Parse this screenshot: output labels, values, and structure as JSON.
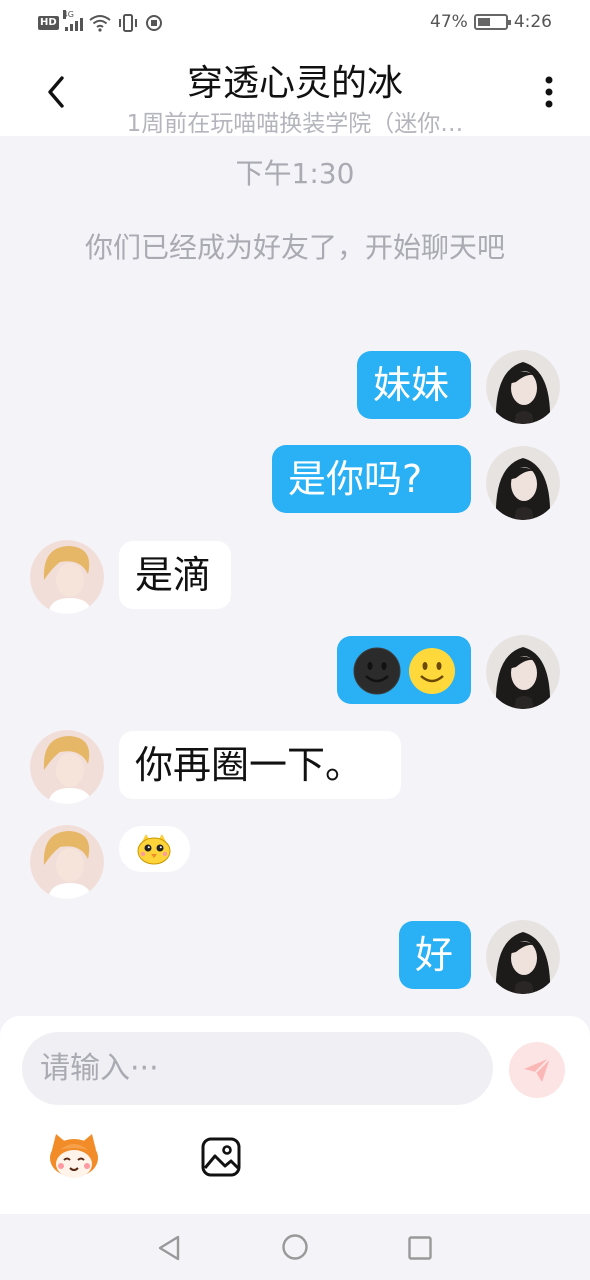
{
  "status_bar": {
    "network": "HD",
    "network_type": "4G",
    "battery_percent": "47%",
    "time": "4:26"
  },
  "header": {
    "title": "穿透心灵的冰",
    "subtitle": "1周前在玩喵喵换装学院（迷你…"
  },
  "chat": {
    "timestamp": "下午1:30",
    "system_message": "你们已经成为好友了，开始聊天吧",
    "messages": [
      {
        "sender": "me",
        "text": "妹妹"
      },
      {
        "sender": "me",
        "text": "是你吗?"
      },
      {
        "sender": "other",
        "text": "是滴"
      },
      {
        "sender": "me",
        "type": "emoji",
        "emojis": [
          "dark-face-emoji",
          "smiley-face-emoji"
        ]
      },
      {
        "sender": "other",
        "text": "你再圈一下。"
      },
      {
        "sender": "other",
        "type": "sticker",
        "sticker": "yellow-chick-sticker"
      },
      {
        "sender": "me",
        "text": "好"
      }
    ]
  },
  "input": {
    "placeholder": "请输入···"
  },
  "colors": {
    "my_bubble": "#2ab0f4",
    "other_bubble": "#ffffff",
    "background": "#f4f3f8",
    "send_button": "#fde4e4"
  }
}
